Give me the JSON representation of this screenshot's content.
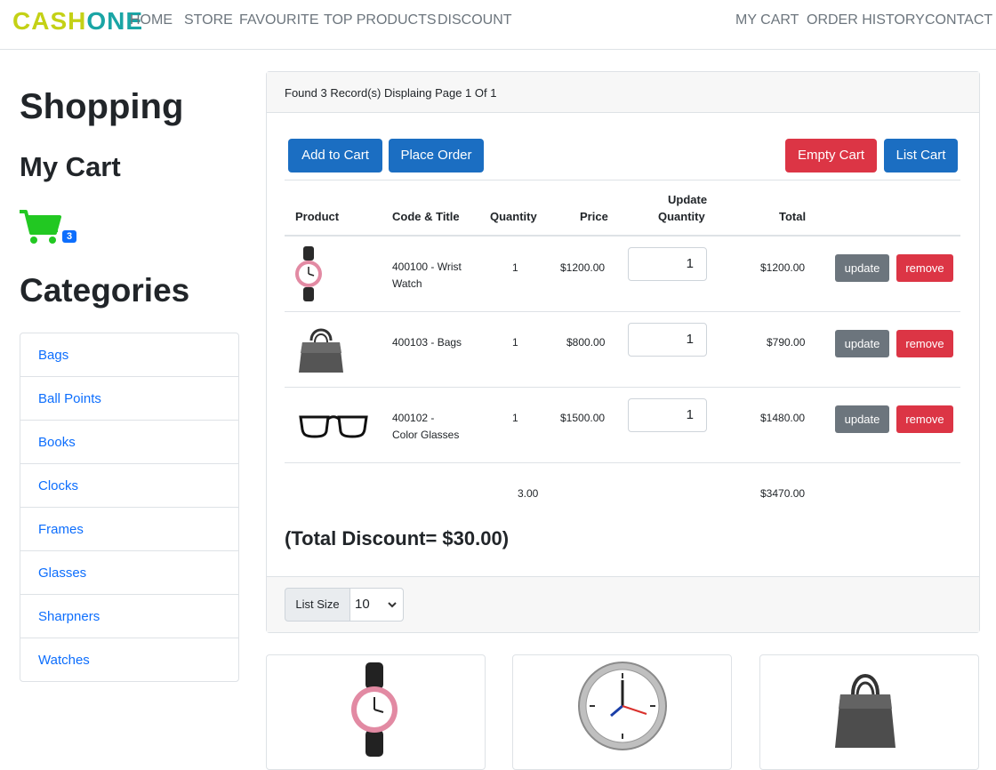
{
  "brand": {
    "part1": "CASH",
    "part2": "ONE"
  },
  "nav": {
    "left": [
      "HOME",
      "STORE",
      "FAVOURITE",
      "TOP PRODUCTS",
      "DISCOUNT"
    ],
    "right": [
      "MY CART",
      "ORDER HISTORY",
      "CONTACT"
    ]
  },
  "sidebar": {
    "shopping_title": "Shopping",
    "mycart_title": "My Cart",
    "cart_count": "3",
    "categories_title": "Categories",
    "categories": [
      "Bags",
      "Ball Points",
      "Books",
      "Clocks",
      "Frames",
      "Glasses",
      "Sharpners",
      "Watches"
    ]
  },
  "cart": {
    "records_text": "Found 3 Record(s) Displaing Page 1 Of 1",
    "buttons": {
      "add_to_cart": "Add to Cart",
      "place_order": "Place Order",
      "empty_cart": "Empty Cart",
      "list_cart": "List Cart"
    },
    "headers": {
      "product": "Product",
      "code_title": "Code & Title",
      "quantity": "Quantity",
      "price": "Price",
      "update_quantity_1": "Update",
      "update_quantity_2": "Quantity",
      "total": "Total"
    },
    "rows": [
      {
        "code_title_1": "400100 - Wrist",
        "code_title_2": "Watch",
        "quantity": "1",
        "price": "$1200.00",
        "update_qty": "1",
        "total": "$1200.00",
        "update_label": "update",
        "remove_label": "remove",
        "icon": "wrist-watch"
      },
      {
        "code_title_1": "400103 - Bags",
        "code_title_2": "",
        "quantity": "1",
        "price": "$800.00",
        "update_qty": "1",
        "total": "$790.00",
        "update_label": "update",
        "remove_label": "remove",
        "icon": "handbag"
      },
      {
        "code_title_1": "400102 -",
        "code_title_2": "Color Glasses",
        "quantity": "1",
        "price": "$1500.00",
        "update_qty": "1",
        "total": "$1480.00",
        "update_label": "update",
        "remove_label": "remove",
        "icon": "glasses"
      }
    ],
    "summary": {
      "total_quantity": "3.00",
      "grand_total": "$3470.00"
    },
    "discount_text": "(Total Discount=  $30.00)",
    "list_size_label": "List Size",
    "list_size_value": "10"
  },
  "colors": {
    "brand_yellow": "#c4d116",
    "brand_teal": "#1aa5a5",
    "primary": "#1b6ec2",
    "danger": "#dc3545",
    "secondary": "#6c757d",
    "cart_green": "#22c822"
  },
  "products_preview": [
    "wrist-watch",
    "wall-clock",
    "handbag"
  ]
}
